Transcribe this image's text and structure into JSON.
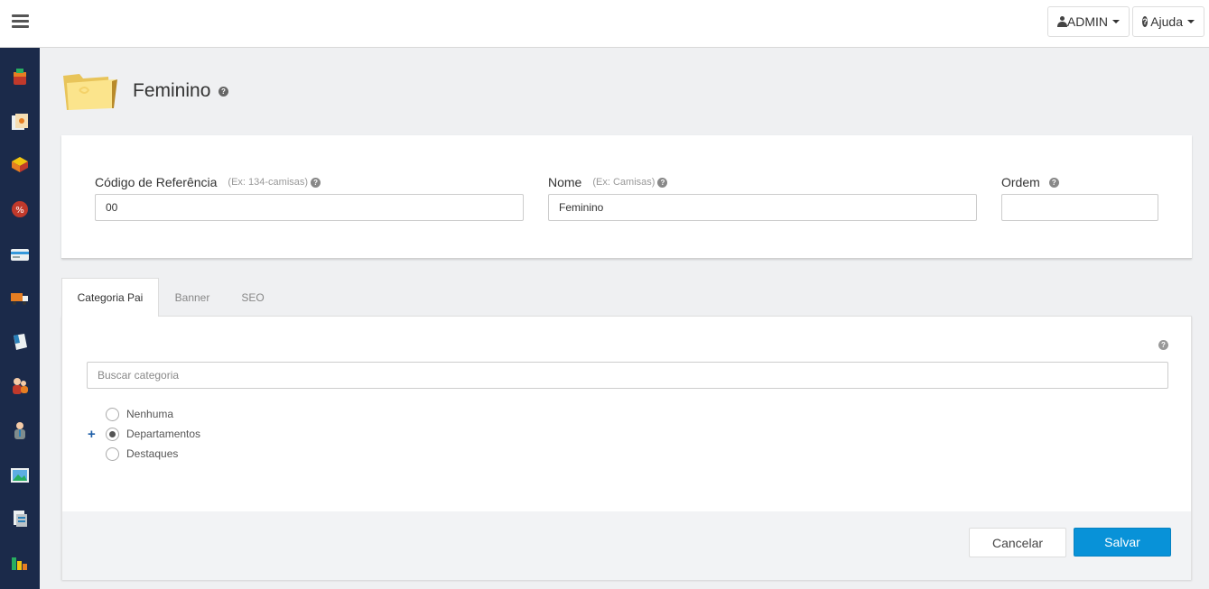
{
  "topbar": {
    "admin_label": "ADMIN",
    "help_label": "Ajuda"
  },
  "sidebar": {
    "items": [
      {
        "icon": "products-icon"
      },
      {
        "icon": "catalog-icon"
      },
      {
        "icon": "packages-icon"
      },
      {
        "icon": "promotions-icon"
      },
      {
        "icon": "payments-icon"
      },
      {
        "icon": "shipping-icon"
      },
      {
        "icon": "orders-icon"
      },
      {
        "icon": "customers-icon"
      },
      {
        "icon": "users-icon"
      },
      {
        "icon": "banners-icon"
      },
      {
        "icon": "reports-icon"
      },
      {
        "icon": "statistics-icon"
      }
    ]
  },
  "header": {
    "title": "Feminino",
    "help_glyph": "?"
  },
  "form": {
    "ref_label": "Código de Referência",
    "ref_hint": "(Ex: 134-camisas)",
    "ref_value": "00",
    "name_label": "Nome",
    "name_hint": "(Ex: Camisas)",
    "name_value": "Feminino",
    "order_label": "Ordem",
    "order_value": ""
  },
  "tabs": {
    "items": [
      "Categoria Pai",
      "Banner",
      "SEO"
    ],
    "active": "Categoria Pai"
  },
  "category": {
    "search_placeholder": "Buscar categoria",
    "options": [
      {
        "label": "Nenhuma",
        "checked": false,
        "expandable": false
      },
      {
        "label": "Departamentos",
        "checked": true,
        "expandable": true,
        "expand_glyph": "+"
      },
      {
        "label": "Destaques",
        "checked": false,
        "expandable": false
      }
    ]
  },
  "footer": {
    "cancel_label": "Cancelar",
    "save_label": "Salvar"
  },
  "colors": {
    "sidebar": "#1b2a4a",
    "primary": "#0892d8",
    "expand": "#1f5fa8"
  }
}
